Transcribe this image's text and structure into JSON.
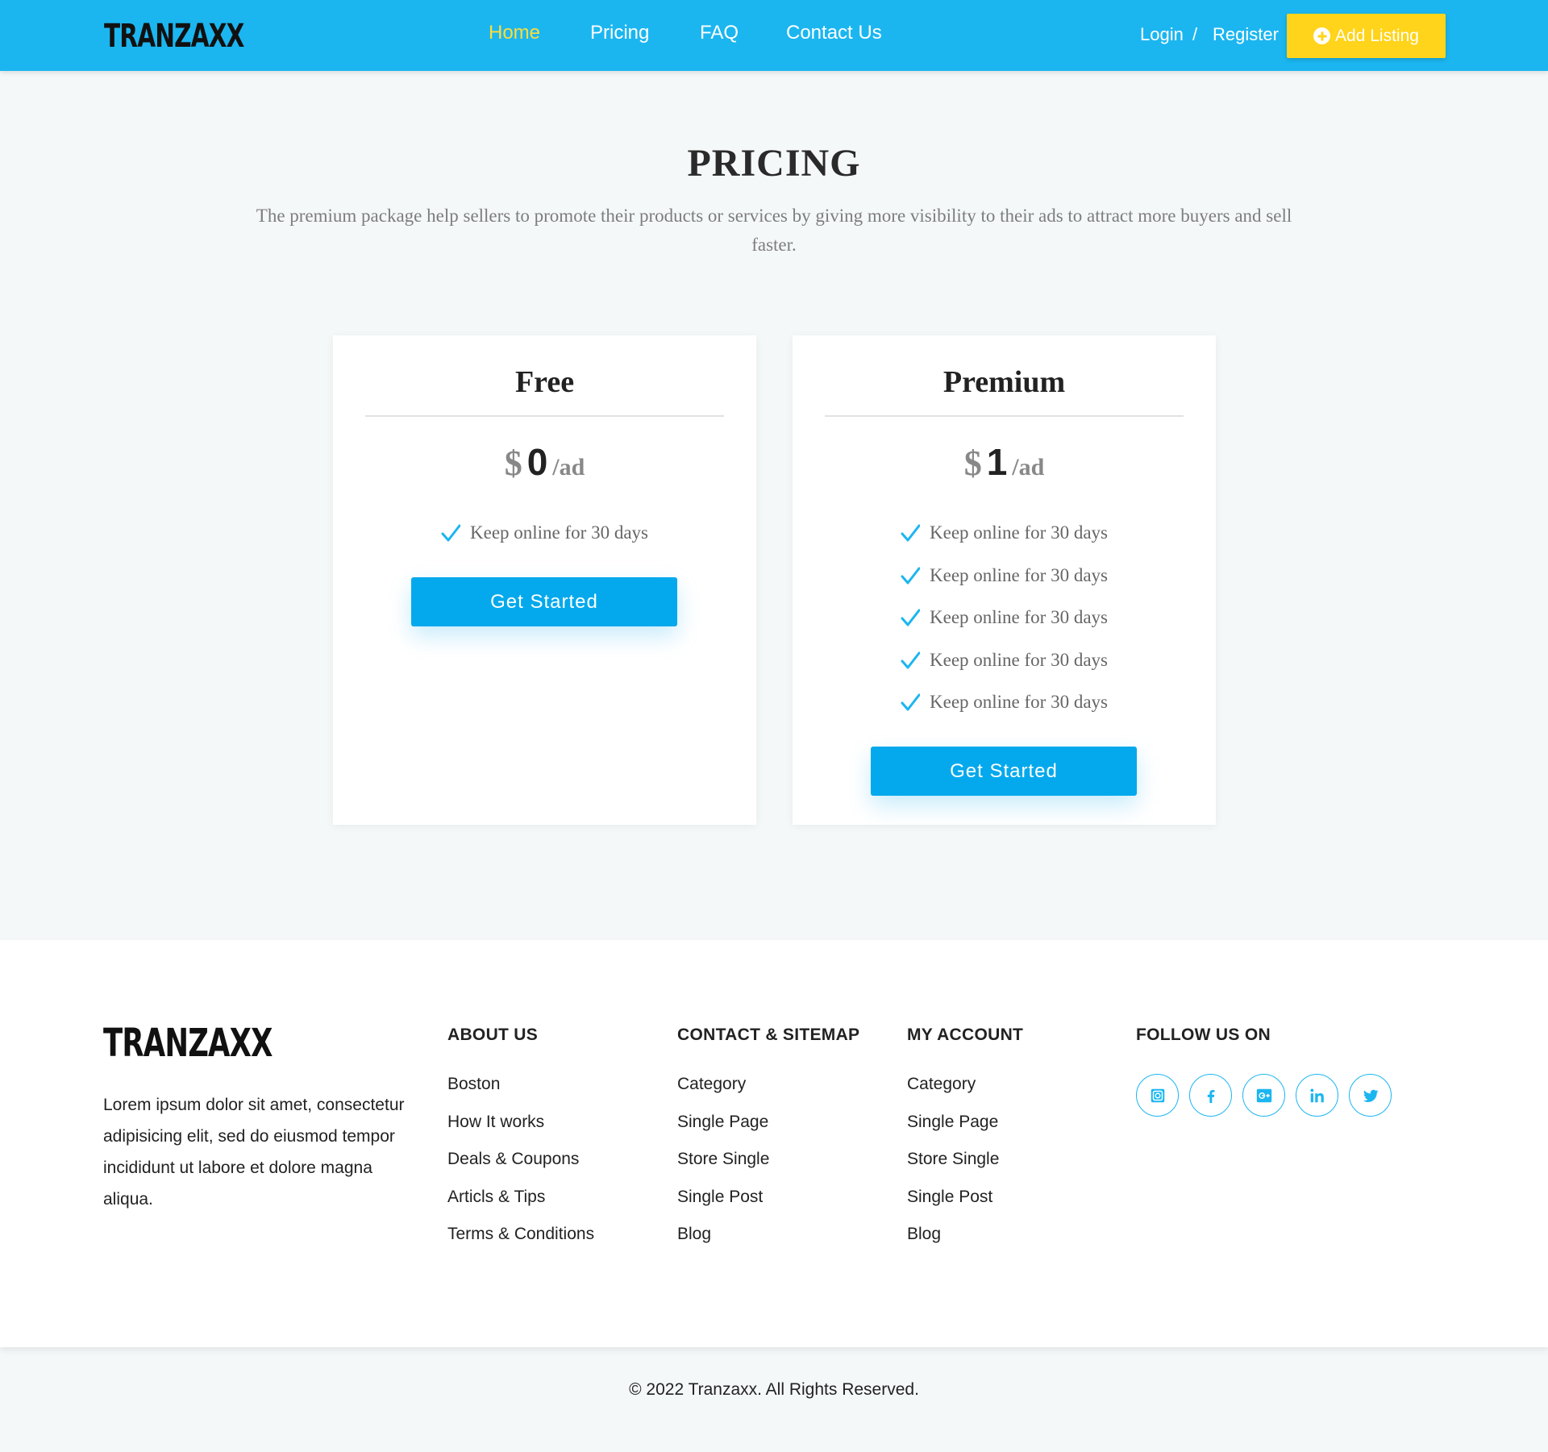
{
  "header": {
    "logo": "TRANZAXX",
    "nav": [
      {
        "label": "Home",
        "active": true
      },
      {
        "label": "Pricing",
        "active": false
      },
      {
        "label": "FAQ",
        "active": false
      },
      {
        "label": "Contact Us",
        "active": false
      }
    ],
    "login": "Login",
    "separator": "/",
    "register": "Register",
    "add_listing": "Add Listing",
    "colors": {
      "bar": "#1bb6f0",
      "active_nav": "#ffdd3a",
      "add_button": "#ffd41a"
    }
  },
  "hero": {
    "title": "PRICING",
    "subtitle": "The premium package help sellers to promote their products or services by giving more visibility to their ads to attract more buyers and sell faster."
  },
  "plans": [
    {
      "name": "Free",
      "currency": "$",
      "amount": "0",
      "per": "/ad",
      "features": [
        "Keep online for 30 days"
      ],
      "cta": "Get Started"
    },
    {
      "name": "Premium",
      "currency": "$",
      "amount": "1",
      "per": "/ad",
      "features": [
        "Keep online for 30 days",
        "Keep online for 30 days",
        "Keep online for 30 days",
        "Keep online for 30 days",
        "Keep online for 30 days"
      ],
      "cta": "Get Started"
    }
  ],
  "footer": {
    "logo": "TRANZAXX",
    "description": "Lorem ipsum dolor sit amet, consectetur adipisicing elit, sed do eiusmod tempor incididunt ut labore et dolore magna aliqua.",
    "columns": [
      {
        "heading": "ABOUT US",
        "links": [
          "Boston",
          "How It works",
          "Deals & Coupons",
          "Articls & Tips",
          "Terms & Conditions"
        ]
      },
      {
        "heading": "CONTACT & SITEMAP",
        "links": [
          "Category",
          "Single Page",
          "Store Single",
          "Single Post",
          "Blog"
        ]
      },
      {
        "heading": "MY ACCOUNT",
        "links": [
          "Category",
          "Single Page",
          "Store Single",
          "Single Post",
          "Blog"
        ]
      }
    ],
    "follow_heading": "FOLLOW US ON",
    "socials": [
      "instagram-icon",
      "facebook-icon",
      "google-plus-icon",
      "linkedin-icon",
      "twitter-icon"
    ],
    "copyright": "© 2022 Tranzaxx. All Rights Reserved.",
    "accent": "#1bb6f0"
  }
}
